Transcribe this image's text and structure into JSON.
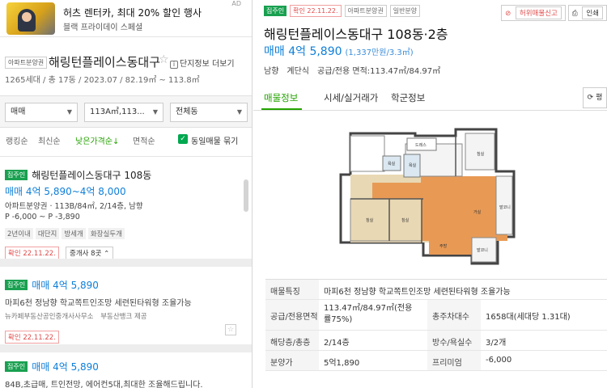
{
  "ad": {
    "title": "허츠 렌터카, 최대 20% 할인 행사",
    "subtitle": "블랙 프라이데이 스페셜",
    "marker": "AD"
  },
  "building": {
    "tag": "아파트분양권",
    "name": "해링턴플레이스동대구",
    "detail_button": "단지정보 더보기",
    "info": "1265세대 / 총 17동 / 2023.07 / 82.19㎡ ~ 113.8㎡"
  },
  "filters": {
    "trade": "매매",
    "area": "113A㎡,113...",
    "dong": "전체동"
  },
  "sort": {
    "ranking": "랭킹순",
    "latest": "최신순",
    "low_price": "낮은가격순↓",
    "area": "면적순",
    "same_listing": "동일매물 묶기"
  },
  "listings": [
    {
      "badge": "집주인",
      "title": "해링턴플레이스동대구 108동",
      "price": "매매 4억 5,890~4억 8,000",
      "meta": "아파트분양권 · 113B/84㎡, 2/14층, 남향",
      "premium": "P -6,000 ~ P -3,890",
      "chips": [
        "2년이내",
        "대단지",
        "방세개",
        "화장실두개"
      ],
      "confirm": "확인 22.11.22.",
      "broker_button": "중개사 8곳 ⌃"
    },
    {
      "badge": "집주인",
      "price": "매매 4억 5,890",
      "desc": "마피6천 정남향 학교쪽트인조망 세련된타워형 조율가능",
      "broker": "뉴카페부동산공인중개사사무소",
      "provider": "부동산뱅크 제공",
      "confirm": "확인 22.11.22."
    },
    {
      "badge": "집주인",
      "price": "매매 4억 5,890",
      "desc": "84B,초급매, 트인전망, 에어컨5대,최대한 조율해드립니다."
    }
  ],
  "detail": {
    "badges": [
      "집주인",
      "확인 22.11.22.",
      "아파트분양권",
      "일반분양"
    ],
    "report": "허위매물신고",
    "print": "인쇄",
    "title": "해링턴플레이스동대구 108동·2층",
    "price": "매매 4억 5,890",
    "price_sub": "(1,337만원/3.3㎡)",
    "meta": [
      "남향",
      "계단식",
      "공급/전용 면적:113.47㎡/84.97㎡"
    ],
    "tabs": [
      "매물정보",
      "시세/실거래가",
      "학군정보"
    ],
    "refresh": "평",
    "table": [
      {
        "h1": "매물특징",
        "v1": "마피6천 정남향 학교쪽트인조망 세련된타워형 조율가능"
      },
      {
        "h1": "공급/전용면적",
        "v1": "113.47㎡/84.97㎡(전용률75%)",
        "h2": "총주차대수",
        "v2": "1658대(세대당 1.31대)"
      },
      {
        "h1": "해당층/총층",
        "v1": "2/14층",
        "h2": "방수/욕실수",
        "v2": "3/2개"
      },
      {
        "h1": "분양가",
        "v1": "5억1,890",
        "h2": "프리미엄",
        "v2": "-6,000"
      }
    ]
  },
  "floorplan_labels": {
    "bath1": "욕실",
    "bath2": "욕실",
    "room1": "침실",
    "room2": "침실",
    "room3": "침실",
    "living": "거실",
    "balcony": "발코니",
    "kitchen": "주방",
    "dress": "드레스"
  },
  "colors": {
    "accent_green": "#24a300",
    "price_blue": "#0e7fd8",
    "badge_green": "#19a050",
    "confirm_red": "#e04b4b"
  }
}
